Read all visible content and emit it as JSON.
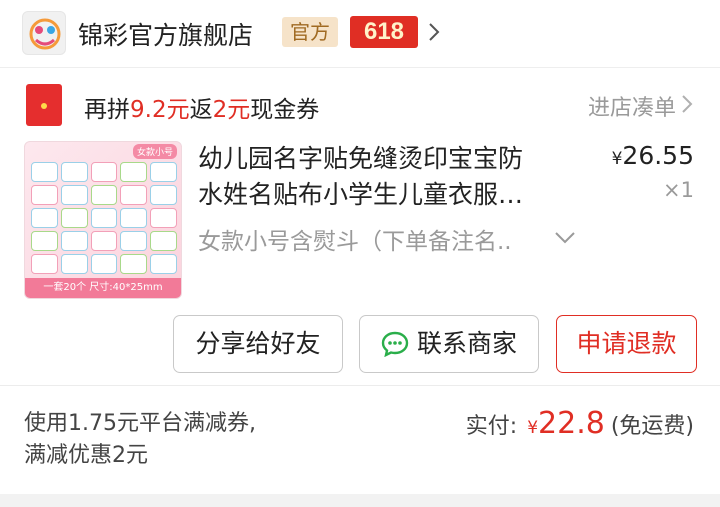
{
  "store": {
    "name": "锦彩官方旗舰店",
    "badge_official": "官方",
    "badge_618": "618"
  },
  "coupon": {
    "prefix": "再拼",
    "amount1": "9.2元",
    "mid": "返",
    "amount2": "2元",
    "suffix": "现金券",
    "action": "进店凑单"
  },
  "product": {
    "title_line1": "幼儿园名字贴免缝烫印宝宝防",
    "title_line2": "水姓名贴布小学生儿童衣服…",
    "price_symbol": "¥",
    "price": "26.55",
    "quantity": "×1",
    "variant": "女款小号含熨斗（下单备注名..",
    "thumb_tag": "女款小号",
    "thumb_footer": "一套20个 尺寸:40*25mm"
  },
  "actions": {
    "share": "分享给好友",
    "contact": "联系商家",
    "refund": "申请退款"
  },
  "summary": {
    "promo_line1": "使用1.75元平台满减券,",
    "promo_line2": "满减优惠2元",
    "pay_label": "实付:",
    "pay_symbol": "¥",
    "pay_amount": "22.8",
    "shipping_note": "(免运费)"
  },
  "colors": {
    "accent": "#e02e24",
    "muted": "#9a9a9a",
    "official_badge_bg": "#f6e3c9"
  }
}
